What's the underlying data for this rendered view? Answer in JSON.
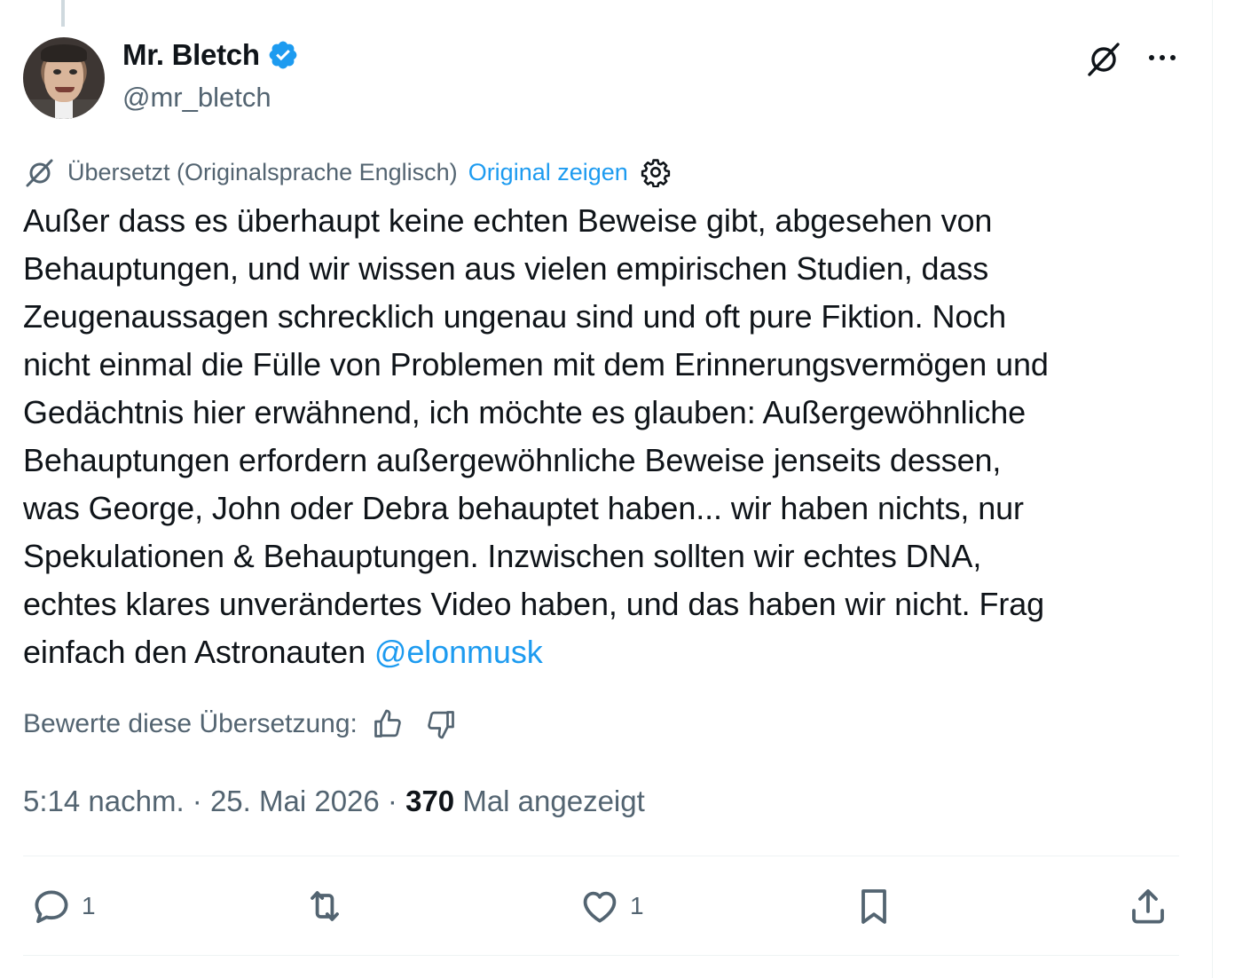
{
  "author": {
    "display_name": "Mr. Bletch",
    "handle": "@mr_bletch",
    "verified": true
  },
  "header_icons": [
    "grok-icon",
    "more-icon"
  ],
  "translation": {
    "label": "Übersetzt (Originalsprache Englisch)",
    "show_original": "Original zeigen",
    "settings_icon": "gear-icon"
  },
  "tweet": {
    "text": "Außer dass es überhaupt keine echten Beweise gibt, abgesehen von\nBehauptungen, und wir wissen aus vielen empirischen Studien, dass\nZeugenaussagen schrecklich ungenau sind und oft pure Fiktion. Noch\nnicht einmal die Fülle von Problemen mit dem Erinnerungsvermögen und\nGedächtnis hier erwähnend, ich möchte es glauben: Außergewöhnliche\nBehauptungen erfordern außergewöhnliche Beweise jenseits dessen,\nwas George, John oder Debra behauptet haben... wir haben nichts, nur\nSpekulationen & Behauptungen. Inzwischen sollten wir echtes DNA,\nechtes klares unverändertes Video haben, und das haben wir nicht. Frag\neinfach den Astronauten ",
    "mention": "@elonmusk"
  },
  "rating": {
    "label": "Bewerte diese Übersetzung:",
    "icons": [
      "thumbs-up-icon",
      "thumbs-down-icon"
    ]
  },
  "meta": {
    "time": "5:14 nachm.",
    "separator": " · ",
    "date": "25. Mai 2026",
    "views_count": "370",
    "views_label": " Mal angezeigt"
  },
  "actions": {
    "reply_count": "1",
    "like_count": "1"
  },
  "colors": {
    "accent": "#1d9bf0",
    "text": "#0f1419",
    "secondary": "#536471",
    "divider": "#eff3f4"
  }
}
